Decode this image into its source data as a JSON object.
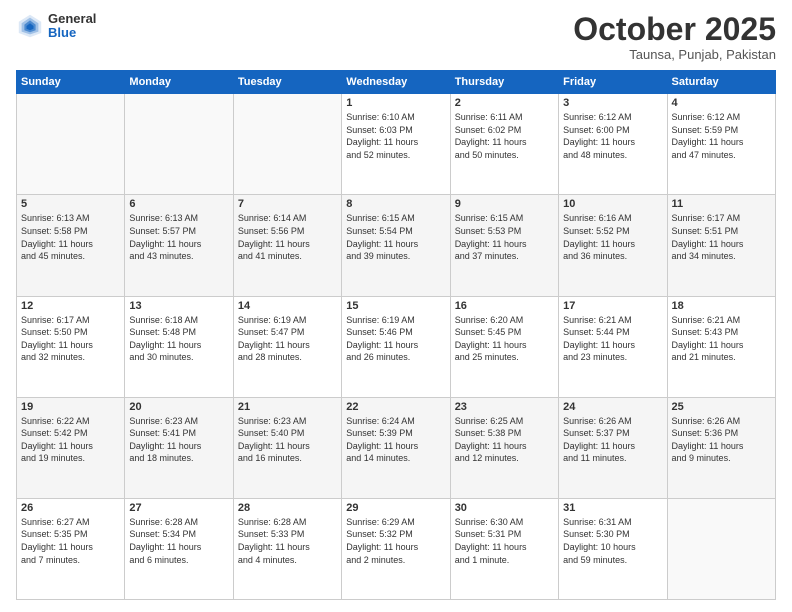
{
  "logo": {
    "general": "General",
    "blue": "Blue"
  },
  "header": {
    "month": "October 2025",
    "location": "Taunsa, Punjab, Pakistan"
  },
  "weekdays": [
    "Sunday",
    "Monday",
    "Tuesday",
    "Wednesday",
    "Thursday",
    "Friday",
    "Saturday"
  ],
  "weeks": [
    [
      {
        "day": "",
        "info": ""
      },
      {
        "day": "",
        "info": ""
      },
      {
        "day": "",
        "info": ""
      },
      {
        "day": "1",
        "info": "Sunrise: 6:10 AM\nSunset: 6:03 PM\nDaylight: 11 hours\nand 52 minutes."
      },
      {
        "day": "2",
        "info": "Sunrise: 6:11 AM\nSunset: 6:02 PM\nDaylight: 11 hours\nand 50 minutes."
      },
      {
        "day": "3",
        "info": "Sunrise: 6:12 AM\nSunset: 6:00 PM\nDaylight: 11 hours\nand 48 minutes."
      },
      {
        "day": "4",
        "info": "Sunrise: 6:12 AM\nSunset: 5:59 PM\nDaylight: 11 hours\nand 47 minutes."
      }
    ],
    [
      {
        "day": "5",
        "info": "Sunrise: 6:13 AM\nSunset: 5:58 PM\nDaylight: 11 hours\nand 45 minutes."
      },
      {
        "day": "6",
        "info": "Sunrise: 6:13 AM\nSunset: 5:57 PM\nDaylight: 11 hours\nand 43 minutes."
      },
      {
        "day": "7",
        "info": "Sunrise: 6:14 AM\nSunset: 5:56 PM\nDaylight: 11 hours\nand 41 minutes."
      },
      {
        "day": "8",
        "info": "Sunrise: 6:15 AM\nSunset: 5:54 PM\nDaylight: 11 hours\nand 39 minutes."
      },
      {
        "day": "9",
        "info": "Sunrise: 6:15 AM\nSunset: 5:53 PM\nDaylight: 11 hours\nand 37 minutes."
      },
      {
        "day": "10",
        "info": "Sunrise: 6:16 AM\nSunset: 5:52 PM\nDaylight: 11 hours\nand 36 minutes."
      },
      {
        "day": "11",
        "info": "Sunrise: 6:17 AM\nSunset: 5:51 PM\nDaylight: 11 hours\nand 34 minutes."
      }
    ],
    [
      {
        "day": "12",
        "info": "Sunrise: 6:17 AM\nSunset: 5:50 PM\nDaylight: 11 hours\nand 32 minutes."
      },
      {
        "day": "13",
        "info": "Sunrise: 6:18 AM\nSunset: 5:48 PM\nDaylight: 11 hours\nand 30 minutes."
      },
      {
        "day": "14",
        "info": "Sunrise: 6:19 AM\nSunset: 5:47 PM\nDaylight: 11 hours\nand 28 minutes."
      },
      {
        "day": "15",
        "info": "Sunrise: 6:19 AM\nSunset: 5:46 PM\nDaylight: 11 hours\nand 26 minutes."
      },
      {
        "day": "16",
        "info": "Sunrise: 6:20 AM\nSunset: 5:45 PM\nDaylight: 11 hours\nand 25 minutes."
      },
      {
        "day": "17",
        "info": "Sunrise: 6:21 AM\nSunset: 5:44 PM\nDaylight: 11 hours\nand 23 minutes."
      },
      {
        "day": "18",
        "info": "Sunrise: 6:21 AM\nSunset: 5:43 PM\nDaylight: 11 hours\nand 21 minutes."
      }
    ],
    [
      {
        "day": "19",
        "info": "Sunrise: 6:22 AM\nSunset: 5:42 PM\nDaylight: 11 hours\nand 19 minutes."
      },
      {
        "day": "20",
        "info": "Sunrise: 6:23 AM\nSunset: 5:41 PM\nDaylight: 11 hours\nand 18 minutes."
      },
      {
        "day": "21",
        "info": "Sunrise: 6:23 AM\nSunset: 5:40 PM\nDaylight: 11 hours\nand 16 minutes."
      },
      {
        "day": "22",
        "info": "Sunrise: 6:24 AM\nSunset: 5:39 PM\nDaylight: 11 hours\nand 14 minutes."
      },
      {
        "day": "23",
        "info": "Sunrise: 6:25 AM\nSunset: 5:38 PM\nDaylight: 11 hours\nand 12 minutes."
      },
      {
        "day": "24",
        "info": "Sunrise: 6:26 AM\nSunset: 5:37 PM\nDaylight: 11 hours\nand 11 minutes."
      },
      {
        "day": "25",
        "info": "Sunrise: 6:26 AM\nSunset: 5:36 PM\nDaylight: 11 hours\nand 9 minutes."
      }
    ],
    [
      {
        "day": "26",
        "info": "Sunrise: 6:27 AM\nSunset: 5:35 PM\nDaylight: 11 hours\nand 7 minutes."
      },
      {
        "day": "27",
        "info": "Sunrise: 6:28 AM\nSunset: 5:34 PM\nDaylight: 11 hours\nand 6 minutes."
      },
      {
        "day": "28",
        "info": "Sunrise: 6:28 AM\nSunset: 5:33 PM\nDaylight: 11 hours\nand 4 minutes."
      },
      {
        "day": "29",
        "info": "Sunrise: 6:29 AM\nSunset: 5:32 PM\nDaylight: 11 hours\nand 2 minutes."
      },
      {
        "day": "30",
        "info": "Sunrise: 6:30 AM\nSunset: 5:31 PM\nDaylight: 11 hours\nand 1 minute."
      },
      {
        "day": "31",
        "info": "Sunrise: 6:31 AM\nSunset: 5:30 PM\nDaylight: 10 hours\nand 59 minutes."
      },
      {
        "day": "",
        "info": ""
      }
    ]
  ]
}
